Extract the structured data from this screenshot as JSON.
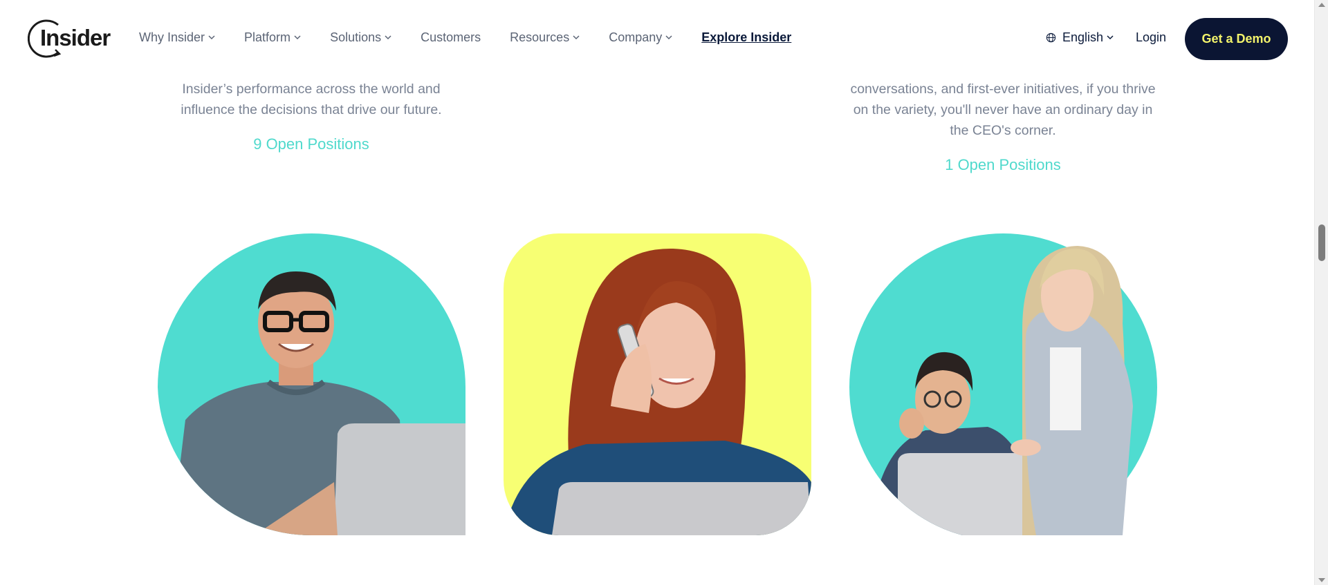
{
  "header": {
    "logo_text": "Insider",
    "nav": [
      {
        "label": "Why Insider",
        "has_menu": true
      },
      {
        "label": "Platform",
        "has_menu": true
      },
      {
        "label": "Solutions",
        "has_menu": true
      },
      {
        "label": "Customers",
        "has_menu": false
      },
      {
        "label": "Resources",
        "has_menu": true
      },
      {
        "label": "Company",
        "has_menu": true
      }
    ],
    "explore_label": "Explore Insider",
    "language_label": "English",
    "login_label": "Login",
    "demo_label": "Get a Demo"
  },
  "teams": [
    {
      "description_lines": [
        "Insider’s performance across the world and",
        "influence the decisions that drive our future."
      ],
      "positions_label": "9 Open Positions"
    },
    {
      "description_lines": [
        "conversations, and first-ever initiatives, if you thrive",
        "on the variety, you'll never have an ordinary day in",
        "the CEO's corner."
      ],
      "positions_label": "1 Open Positions"
    }
  ],
  "colors": {
    "brand_navy": "#0b1533",
    "accent_teal": "#4fd9cc",
    "accent_yellow": "#f7ff73",
    "demo_text": "#f3f36b"
  },
  "images": [
    {
      "icon": "man-with-glasses-laptop-photo"
    },
    {
      "icon": "woman-on-phone-photo"
    },
    {
      "icon": "two-colleagues-laptop-photo"
    }
  ]
}
